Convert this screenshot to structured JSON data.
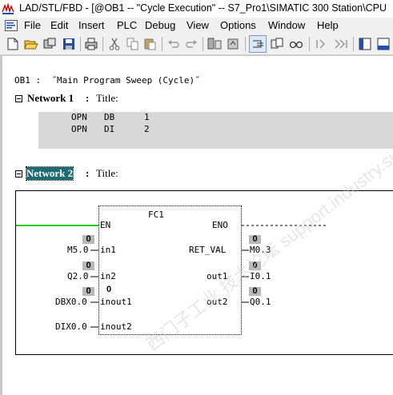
{
  "window": {
    "title": "LAD/STL/FBD  - [@OB1 -- \"Cycle Execution\" -- S7_Pro1\\SIMATIC 300 Station\\CPU"
  },
  "menu": [
    "File",
    "Edit",
    "Insert",
    "PLC",
    "Debug",
    "View",
    "Options",
    "Window",
    "Help"
  ],
  "toolbar_icons": [
    "new-icon",
    "open-icon",
    "online-offline-icon",
    "save-icon",
    "print-icon",
    "cut-icon",
    "copy-icon",
    "paste-icon",
    "undo-icon",
    "redo-icon",
    "download-icon",
    "upload-icon",
    "compare-icon",
    "module-info-icon",
    "monitor-icon",
    "glasses-icon",
    "breakpoint-icon",
    "next-icon",
    "prev-icon",
    "overview-icon",
    "details-icon"
  ],
  "block": {
    "header": "OB1 :  ˝Main Program Sweep (Cycle)˝"
  },
  "network1": {
    "label": "Network 1",
    "title_label": "Title:",
    "stl": [
      {
        "op": "OPN",
        "arg": "DB",
        "val": "1"
      },
      {
        "op": "OPN",
        "arg": "DI",
        "val": "2"
      }
    ]
  },
  "network2": {
    "label": "Network 2",
    "title_label": "Title:",
    "fb": {
      "name": "FC1",
      "en": "EN",
      "eno": "ENO",
      "inputs": [
        {
          "param": "in1",
          "operand": "M5.0",
          "status": "0"
        },
        {
          "param": "in2",
          "operand": "Q2.0",
          "status": "0"
        },
        {
          "param": "inout1",
          "operand": "DBX0.0",
          "status": "0",
          "status2": "0"
        },
        {
          "param": "inout2",
          "operand": "DIX0.0"
        }
      ],
      "outputs": [
        {
          "param": "RET_VAL",
          "operand": "M0.3",
          "status": "0"
        },
        {
          "param": "out1",
          "operand": "I0.1",
          "status": "0"
        },
        {
          "param": "out2",
          "operand": "Q0.1",
          "status": "0"
        }
      ]
    }
  },
  "watermark": "西门子工业 技术论坛  support.industry.siemens.com/cs",
  "colors": {
    "power_flow": "#22cc22",
    "network_highlight": "#1f6b74",
    "stl_background": "#d8d8d8",
    "status_box": "#b8b8b8"
  }
}
